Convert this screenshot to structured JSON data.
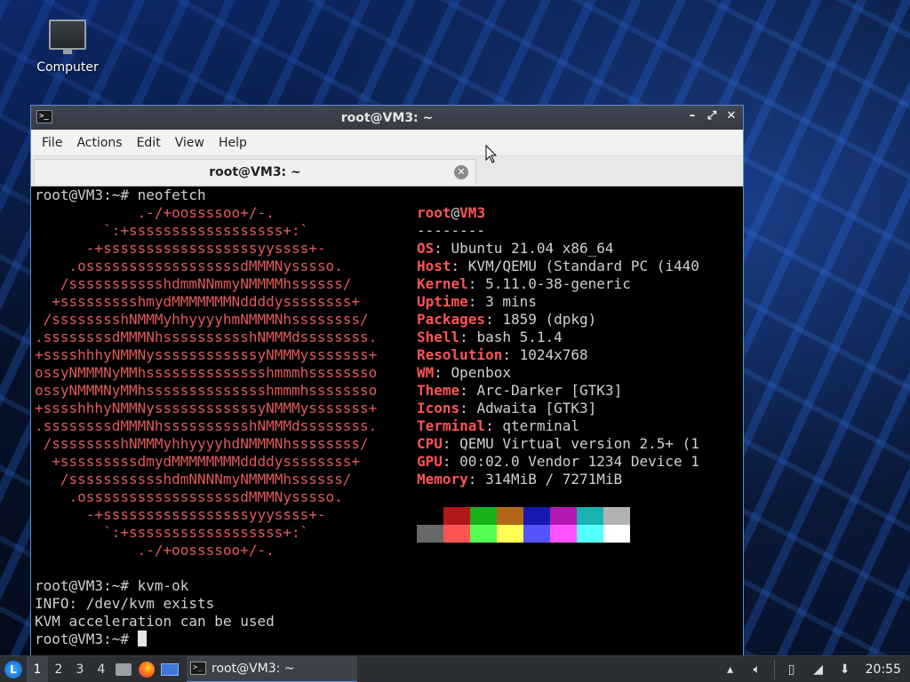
{
  "desktop": {
    "icon_label": "Computer"
  },
  "window": {
    "title": "root@VM3: ~",
    "controls": {
      "minimize": "–",
      "maximize": "⤢",
      "close": "✕"
    },
    "menu": [
      "File",
      "Actions",
      "Edit",
      "View",
      "Help"
    ],
    "tab_label": "root@VM3: ~"
  },
  "terminal": {
    "cmd1": "root@VM3:~# neofetch",
    "logo": [
      "            .-/+oossssoo+/-.",
      "        `:+ssssssssssssssssss+:`",
      "      -+ssssssssssssssssssyyssss+-",
      "    .ossssssssssssssssssdMMMNysssso.",
      "   /ssssssssssshdmmNNmmyNMMMMhssssss/",
      "  +ssssssssshmydMMMMMMMNddddyssssssss+",
      " /sssssssshNMMMyhhyyyyhmNMMMNhssssssss/",
      ".ssssssssdMMMNhsssssssssshNMMMdssssssss.",
      "+sssshhhyNMMNyssssssssssssyNMMMysssssss+",
      "ossyNMMMNyMMhsssssssssssssshmmmhssssssso",
      "ossyNMMMNyMMhsssssssssssssshmmmhssssssso",
      "+sssshhhyNMMNyssssssssssssyNMMMysssssss+",
      ".ssssssssdMMMNhsssssssssshNMMMdssssssss.",
      " /sssssssshNMMMyhhyyyyhdNMMMNhssssssss/",
      "  +sssssssssdmydMMMMMMMMddddyssssssss+",
      "   /ssssssssssshdmNNNNmyNMMMMhssssss/",
      "    .ossssssssssssssssssdMMMNysssso.",
      "      -+sssssssssssssssssyyyssss+-",
      "        `:+ssssssssssssssssss+:`",
      "            .-/+oossssoo+/-."
    ],
    "user": "root",
    "at": "@",
    "host": "VM3",
    "separator": "--------",
    "info": [
      {
        "key": "OS",
        "value": "Ubuntu 21.04 x86_64"
      },
      {
        "key": "Host",
        "value": "KVM/QEMU (Standard PC (i440"
      },
      {
        "key": "Kernel",
        "value": "5.11.0-38-generic"
      },
      {
        "key": "Uptime",
        "value": "3 mins"
      },
      {
        "key": "Packages",
        "value": "1859 (dpkg)"
      },
      {
        "key": "Shell",
        "value": "bash 5.1.4"
      },
      {
        "key": "Resolution",
        "value": "1024x768"
      },
      {
        "key": "WM",
        "value": "Openbox"
      },
      {
        "key": "Theme",
        "value": "Arc-Darker [GTK3]"
      },
      {
        "key": "Icons",
        "value": "Adwaita [GTK3]"
      },
      {
        "key": "Terminal",
        "value": "qterminal"
      },
      {
        "key": "CPU",
        "value": "QEMU Virtual version 2.5+ (1"
      },
      {
        "key": "GPU",
        "value": "00:02.0 Vendor 1234 Device 1"
      },
      {
        "key": "Memory",
        "value": "314MiB / 7271MiB"
      }
    ],
    "swatch_row1": [
      "#000000",
      "#b21818",
      "#18b218",
      "#b26818",
      "#1818b2",
      "#b218b2",
      "#18b2b2",
      "#b2b2b2"
    ],
    "swatch_row2": [
      "#686868",
      "#ff5454",
      "#54ff54",
      "#ffff54",
      "#5454ff",
      "#ff54ff",
      "#54ffff",
      "#ffffff"
    ],
    "cmd2": "root@VM3:~# kvm-ok",
    "out1": "INFO: /dev/kvm exists",
    "out2": "KVM acceleration can be used",
    "prompt": "root@VM3:~# "
  },
  "taskbar": {
    "start_label": "L",
    "workspaces": [
      "1",
      "2",
      "3",
      "4"
    ],
    "task_label": "root@VM3: ~",
    "clock": "20:55"
  }
}
